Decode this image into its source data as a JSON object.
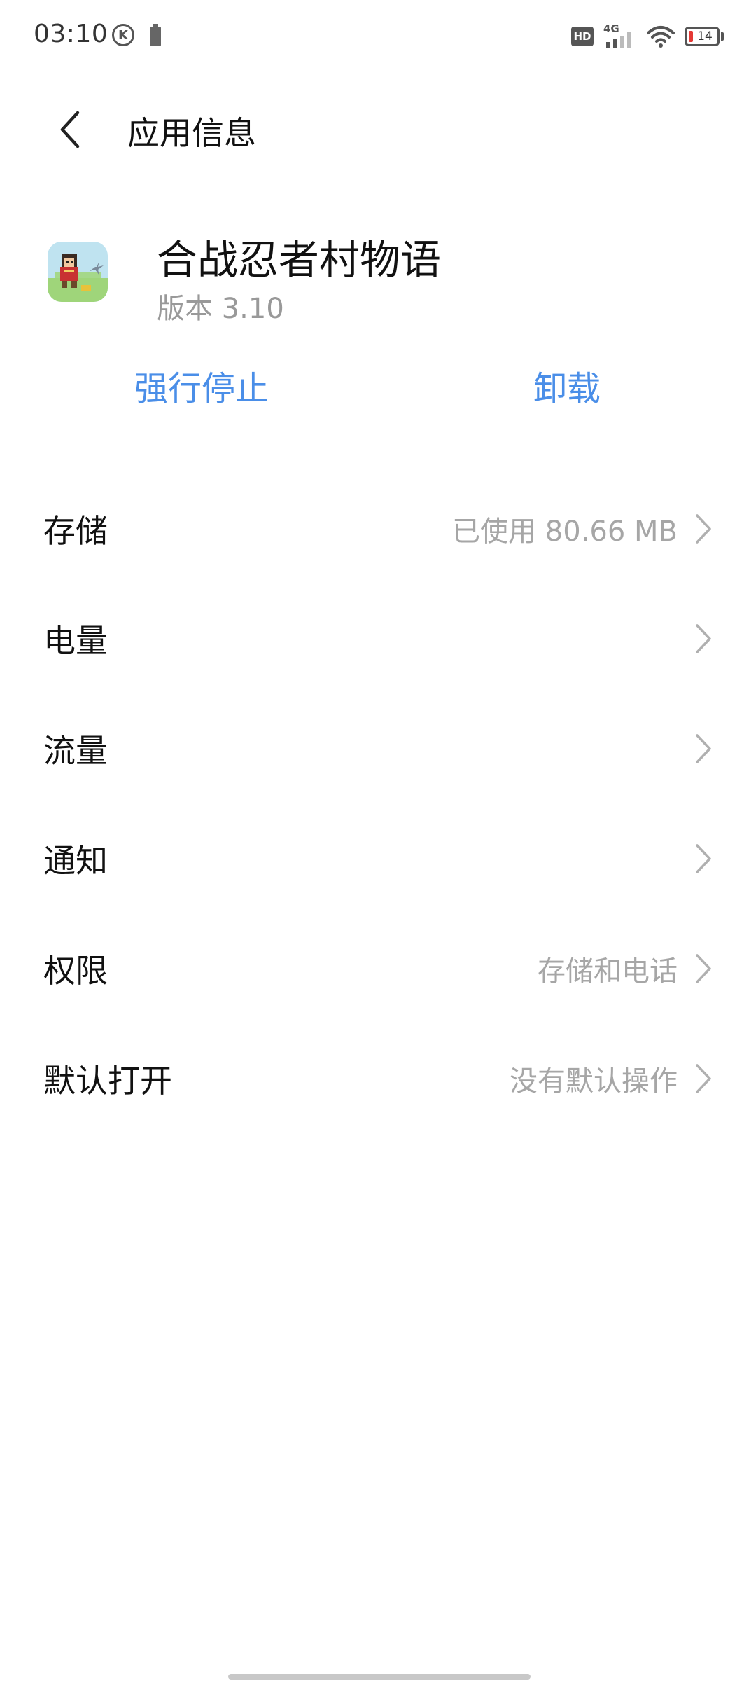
{
  "status_bar": {
    "time": "03:10",
    "k_badge": "K",
    "hd": "HD",
    "network": "4G",
    "battery": "14"
  },
  "header": {
    "title": "应用信息"
  },
  "app": {
    "name": "合战忍者村物语",
    "version": "版本 3.10"
  },
  "actions": {
    "force_stop": "强行停止",
    "uninstall": "卸载"
  },
  "settings": [
    {
      "label": "存储",
      "value": "已使用 80.66 MB"
    },
    {
      "label": "电量",
      "value": ""
    },
    {
      "label": "流量",
      "value": ""
    },
    {
      "label": "通知",
      "value": ""
    },
    {
      "label": "权限",
      "value": "存储和电话"
    },
    {
      "label": "默认打开",
      "value": "没有默认操作"
    }
  ],
  "colors": {
    "accent": "#4a8ee8",
    "secondary_text": "#a6a6a6",
    "battery_low": "#e53935"
  },
  "icons": [
    "back-arrow-icon",
    "chevron-right-icon",
    "wifi-icon",
    "signal-icon",
    "battery-icon"
  ]
}
